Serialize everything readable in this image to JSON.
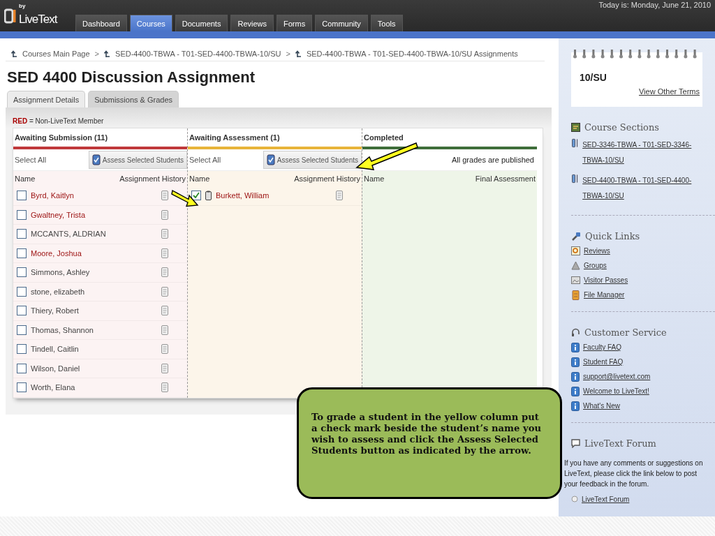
{
  "header": {
    "logo_by": "by",
    "logo_name": "LiveText",
    "date": "Today is: Monday, June 21, 2010",
    "nav": [
      {
        "label": "Dashboard",
        "selected": false
      },
      {
        "label": "Courses",
        "selected": true
      },
      {
        "label": "Documents",
        "selected": false
      },
      {
        "label": "Reviews",
        "selected": false
      },
      {
        "label": "Forms",
        "selected": false
      },
      {
        "label": "Community",
        "selected": false
      },
      {
        "label": "Tools",
        "selected": false
      }
    ]
  },
  "breadcrumbs": [
    {
      "label": "Courses Main Page"
    },
    {
      "label": "SED-4400-TBWA - T01-SED-4400-TBWA-10/SU"
    },
    {
      "label": "SED-4400-TBWA - T01-SED-4400-TBWA-10/SU Assignments"
    }
  ],
  "breadcrumb_separator": ">",
  "title": "SED 4400 Discussion Assignment",
  "tabs": [
    {
      "label": "Assignment Details",
      "selected": false
    },
    {
      "label": "Submissions & Grades",
      "selected": true
    }
  ],
  "legend": {
    "marker": "RED",
    "text": "= Non-LiveText Member"
  },
  "columns": [
    {
      "kind": "submission",
      "title": "Awaiting Submission (11)",
      "color": "#c0393b",
      "select_all": "Select All",
      "button": "Assess Selected Students",
      "name_header": "Name",
      "second_header": "Assignment History",
      "rows": [
        {
          "name": "Byrd, Kaitlyn",
          "non_member": true,
          "checked": false
        },
        {
          "name": "Gwaltney, Trista",
          "non_member": true,
          "checked": false
        },
        {
          "name": "MCCANTS, ALDRIAN",
          "non_member": false,
          "checked": false
        },
        {
          "name": "Moore, Joshua",
          "non_member": true,
          "checked": false
        },
        {
          "name": "Simmons, Ashley",
          "non_member": false,
          "checked": false
        },
        {
          "name": "stone, elizabeth",
          "non_member": false,
          "checked": false
        },
        {
          "name": "Thiery, Robert",
          "non_member": false,
          "checked": false
        },
        {
          "name": "Thomas, Shannon",
          "non_member": false,
          "checked": false
        },
        {
          "name": "Tindell, Caitlin",
          "non_member": false,
          "checked": false
        },
        {
          "name": "Wilson, Daniel",
          "non_member": false,
          "checked": false
        },
        {
          "name": "Worth, Elana",
          "non_member": false,
          "checked": false
        }
      ]
    },
    {
      "kind": "assessment",
      "title": "Awaiting Assessment (1)",
      "color": "#e8b43a",
      "select_all": "Select All",
      "button": "Assess Selected Students",
      "name_header": "Name",
      "second_header": "Assignment History",
      "rows": [
        {
          "name": "Burkett, William",
          "non_member": true,
          "checked": true
        }
      ]
    },
    {
      "kind": "completed",
      "title": "Completed",
      "color": "#3f6e3a",
      "status": "All grades are published",
      "name_header": "Name",
      "second_header": "Final Assessment"
    }
  ],
  "sidebar": {
    "term": "10/SU",
    "term_link": "View Other Terms",
    "sections": [
      {
        "kind": "courses",
        "title": "Course Sections",
        "links": [
          "SED-3346-TBWA - T01-SED-3346-TBWA-10/SU",
          "SED-4400-TBWA - T01-SED-4400-TBWA-10/SU"
        ]
      },
      {
        "kind": "quick",
        "title": "Quick Links",
        "links": [
          "Reviews",
          "Groups",
          "Visitor Passes",
          "File Manager"
        ]
      },
      {
        "kind": "support",
        "title": "Customer Service",
        "links": [
          "Faculty FAQ",
          "Student FAQ",
          "support@livetext.com",
          "Welcome to LiveText!",
          "What's New"
        ]
      }
    ],
    "forum": {
      "title": "LiveText Forum",
      "text": "If you have any comments or suggestions on LiveText, please click the link below to post your feedback in the forum.",
      "link": "LiveText Forum"
    }
  },
  "callout": {
    "text": "To grade a student in the yellow column put a check mark beside the student’s name you wish to assess and click the Assess Selected Students button as indicated by the arrow."
  }
}
